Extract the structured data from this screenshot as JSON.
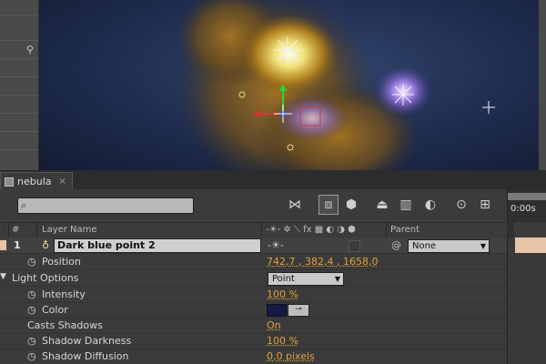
{
  "composition": {
    "tab_label": "nebula",
    "tab_close": "×"
  },
  "search": {
    "value": "",
    "placeholder": ""
  },
  "timeline_ruler": {
    "label": "0:00s"
  },
  "columns": {
    "number": "#",
    "layer_name": "Layer Name",
    "switches": "-☀-  ✲  ⟍ fx ▦ ◐ ◑ ⬢",
    "parent": "Parent"
  },
  "layer": {
    "index": "1",
    "name": "Dark blue point 2",
    "parent_value": "None"
  },
  "properties": {
    "position_label": "Position",
    "position_value": "742,7 , 382,4 , 1658,0",
    "light_options_label": "Light Options",
    "light_type_value": "Point",
    "intensity_label": "Intensity",
    "intensity_value": "100 %",
    "color_label": "Color",
    "color_swatch": "#141a44",
    "casts_shadows_label": "Casts Shadows",
    "casts_shadows_value": "On",
    "shadow_darkness_label": "Shadow Darkness",
    "shadow_darkness_value": "100 %",
    "shadow_diffusion_label": "Shadow Diffusion",
    "shadow_diffusion_value": "0,0 pixels"
  },
  "colors": {
    "value_orange": "#e0a03a",
    "label_bar": "#e7c4a6",
    "comp_bg": "#1e2c4e"
  }
}
